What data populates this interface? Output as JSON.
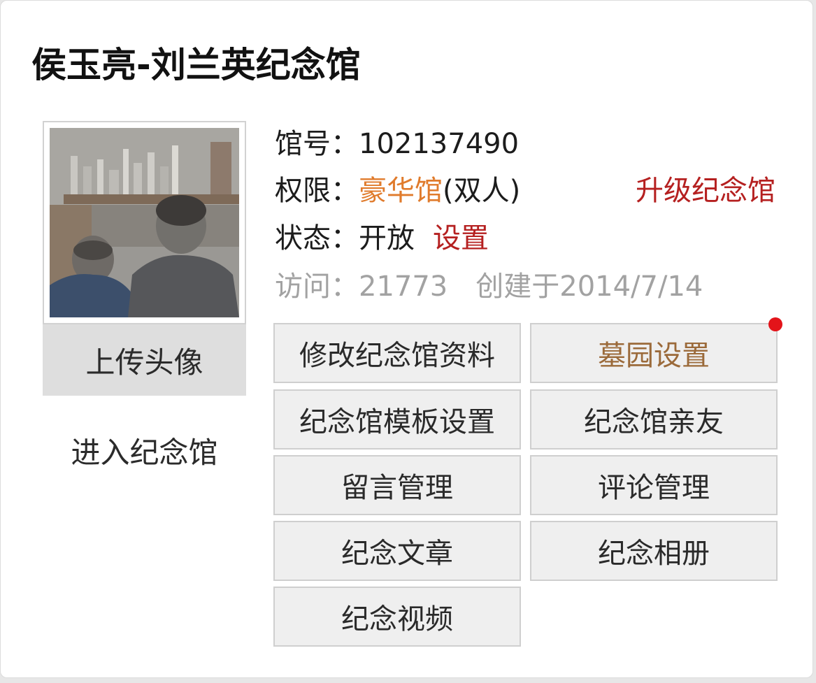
{
  "title": "侯玉亮-刘兰英纪念馆",
  "avatar": {
    "upload_label": "上传头像",
    "enter_label": "进入纪念馆"
  },
  "info": {
    "hall_no_label": "馆号：",
    "hall_no_value": "102137490",
    "permission_label": "权限：",
    "permission_value": "豪华馆",
    "permission_suffix": "(双人)",
    "upgrade_label": "升级纪念馆",
    "status_label": "状态：",
    "status_value": "开放",
    "status_setting_label": "设置",
    "visits_label": "访问：",
    "visits_value": "21773",
    "created_text": "创建于2014/7/14"
  },
  "buttons": {
    "edit_info": "修改纪念馆资料",
    "cemetery_settings": "墓园设置",
    "template_settings": "纪念馆模板设置",
    "relatives": "纪念馆亲友",
    "message_management": "留言管理",
    "comment_management": "评论管理",
    "articles": "纪念文章",
    "albums": "纪念相册",
    "videos": "纪念视频"
  },
  "colors": {
    "premium_orange": "#e07b2c",
    "action_red": "#b52020",
    "cemetery_brown": "#9b6a3a",
    "notification_dot": "#e3141a"
  }
}
